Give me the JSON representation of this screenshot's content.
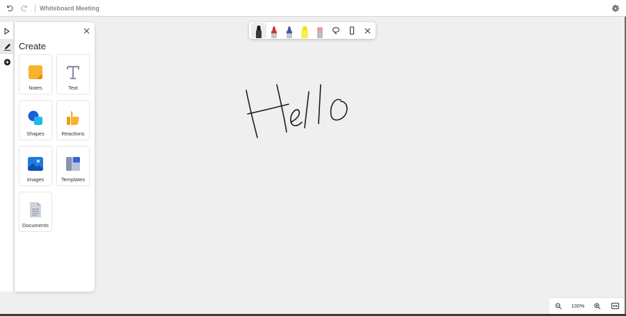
{
  "window": {
    "title": "Whiteboard Meeting"
  },
  "create_panel": {
    "title": "Create",
    "tiles": [
      {
        "label": "Notes",
        "icon": "sticky-note-icon"
      },
      {
        "label": "Text",
        "icon": "text-icon"
      },
      {
        "label": "Shapes",
        "icon": "shapes-icon"
      },
      {
        "label": "Reactions",
        "icon": "thumbs-up-icon"
      },
      {
        "label": "Images",
        "icon": "image-icon"
      },
      {
        "label": "Templates",
        "icon": "templates-icon"
      },
      {
        "label": "Documents",
        "icon": "document-icon"
      }
    ]
  },
  "pen_toolbar": {
    "pens": [
      {
        "name": "black-pen",
        "color": "#1a1a1a"
      },
      {
        "name": "red-pen",
        "color": "#d13438"
      },
      {
        "name": "blue-pen",
        "color": "#3a5ba8"
      },
      {
        "name": "yellow-highlighter",
        "color": "#f2e600"
      },
      {
        "name": "eraser",
        "color": "#e8a0a0"
      }
    ]
  },
  "canvas": {
    "ink_text": "Hello",
    "ink_color": "#1a1a1a"
  },
  "zoom": {
    "level": "100%"
  }
}
